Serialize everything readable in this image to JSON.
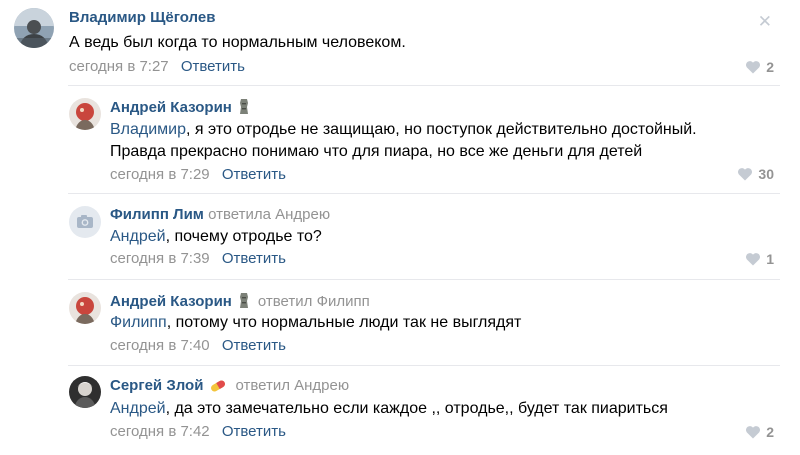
{
  "close_label": "✕",
  "comments": [
    {
      "author": "Владимир Щёголев",
      "reply_to": "",
      "mention": "",
      "text": "А ведь был когда то нормальным человеком.",
      "time": "сегодня в 7:27",
      "reply_label": "Ответить",
      "likes": "2"
    },
    {
      "author": "Андрей Казорин",
      "reply_to": "",
      "mention": "Владимир",
      "text": ", я это отродье не защищаю, но поступок действительно достойный.",
      "text2": "Правда прекрасно понимаю что для пиара, но все же деньги для детей",
      "time": "сегодня в 7:29",
      "reply_label": "Ответить",
      "likes": "30"
    },
    {
      "author": "Филипп Лим",
      "reply_to": "ответила Андрею",
      "mention": "Андрей",
      "text": ", почему отродье то?",
      "time": "сегодня в 7:39",
      "reply_label": "Ответить",
      "likes": "1"
    },
    {
      "author": "Андрей Казорин",
      "reply_to": "ответил Филипп",
      "mention": "Филипп",
      "text": ", потому что нормальные люди так не выглядят",
      "time": "сегодня в 7:40",
      "reply_label": "Ответить",
      "likes": ""
    },
    {
      "author": "Сергей Злой",
      "reply_to": "ответил Андрею",
      "mention": "Андрей",
      "text": ", да это замечательно если каждое ,, отродье,, будет так пиариться",
      "time": "сегодня в 7:42",
      "reply_label": "Ответить",
      "likes": "2"
    }
  ],
  "colors": {
    "link": "#2a5885",
    "meta": "#939393",
    "like_icon": "#c5cbd3"
  }
}
